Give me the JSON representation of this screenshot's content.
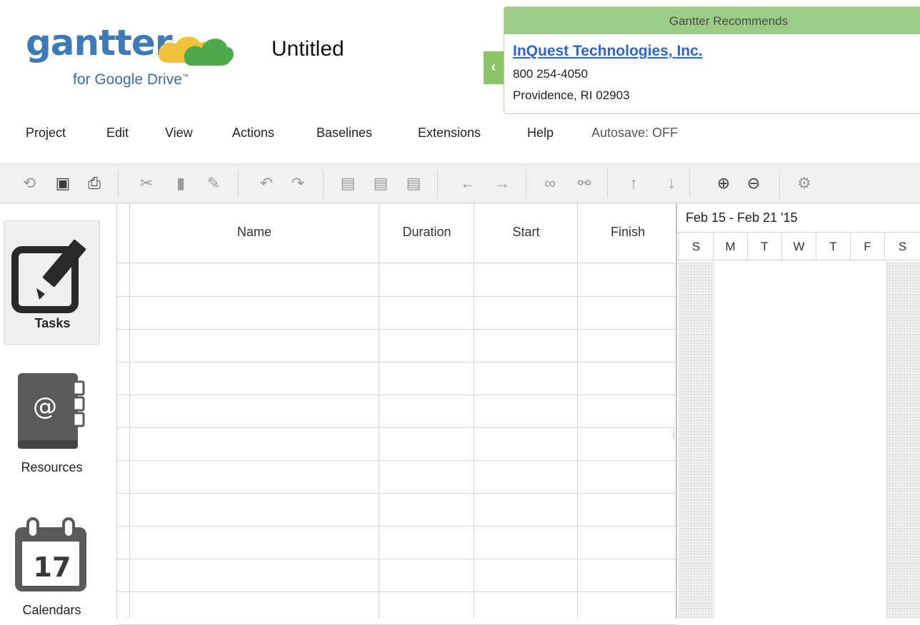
{
  "app": {
    "logo_word": "gantter",
    "logo_sub": "for Google Drive",
    "logo_tm": "™",
    "document_title": "Untitled"
  },
  "recommends": {
    "header": "Gantter Recommends",
    "company": "InQuest Technologies, Inc.",
    "phone": "800 254-4050",
    "address": "Providence, RI 02903",
    "toggle_icon": "chevron-left-icon"
  },
  "menu": {
    "items": [
      "Project",
      "Edit",
      "View",
      "Actions",
      "Baselines",
      "Extensions",
      "Help"
    ],
    "status": "Autosave: OFF"
  },
  "toolbar": {
    "icons": [
      "refresh-icon",
      "save-icon",
      "print-icon",
      "cut-icon",
      "copy-icon",
      "paint-format-icon",
      "undo-icon",
      "redo-icon",
      "insert-task-icon",
      "insert-summary-icon",
      "insert-milestone-icon",
      "outdent-icon",
      "indent-icon",
      "link-icon",
      "unlink-icon",
      "move-up-icon",
      "move-down-icon",
      "zoom-in-icon",
      "zoom-out-icon",
      "settings-icon"
    ]
  },
  "sidenav": {
    "tasks": "Tasks",
    "resources": "Resources",
    "calendars": "Calendars",
    "calendar_day": "17"
  },
  "grid": {
    "columns": [
      "Name",
      "Duration",
      "Start",
      "Finish"
    ],
    "row_count": 11
  },
  "gantt": {
    "week_label": "Feb 15 - Feb 21 '15",
    "days": [
      "S",
      "M",
      "T",
      "W",
      "T",
      "F",
      "S"
    ]
  },
  "colors": {
    "accent_green": "#9ccd86",
    "link_blue": "#3066cc",
    "logo_blue": "#3d7ab8"
  }
}
